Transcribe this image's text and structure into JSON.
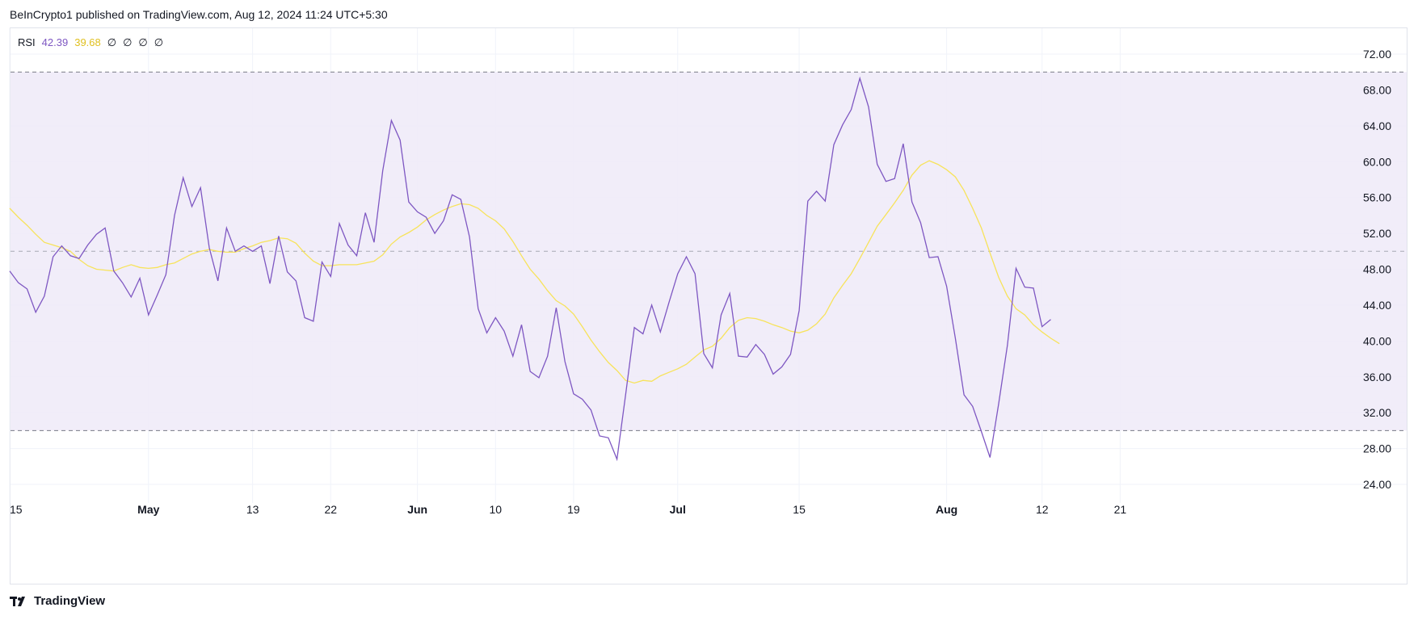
{
  "header": {
    "publish_line": "BeInCrypto1 published on TradingView.com, Aug 12, 2024 11:24 UTC+5:30"
  },
  "legend": {
    "indicator": "RSI",
    "rsi_value": "42.39",
    "ma_value": "39.68",
    "na_values": [
      "∅",
      "∅",
      "∅",
      "∅"
    ]
  },
  "footer": {
    "logo_text": "TradingView"
  },
  "colors": {
    "rsi_line": "#7e57c2",
    "ma_line": "#f7e35b",
    "band_fill": "#efebf8",
    "dashed": "#787b86",
    "grid": "#f0f3fa"
  },
  "chart_data": {
    "type": "line",
    "title": "RSI",
    "ylim": [
      22,
      74
    ],
    "y_ticks": [
      "72.00",
      "68.00",
      "64.00",
      "60.00",
      "56.00",
      "52.00",
      "48.00",
      "44.00",
      "40.00",
      "36.00",
      "32.00",
      "28.00",
      "24.00"
    ],
    "y_tick_values": [
      72,
      68,
      64,
      60,
      56,
      52,
      48,
      44,
      40,
      36,
      32,
      28,
      24
    ],
    "bands": {
      "upper": 70,
      "middle": 50,
      "lower": 30
    },
    "x_ticks": [
      {
        "label": "15",
        "index": 0,
        "bold": false
      },
      {
        "label": "May",
        "index": 16,
        "bold": true
      },
      {
        "label": "13",
        "index": 28,
        "bold": false
      },
      {
        "label": "22",
        "index": 37,
        "bold": false
      },
      {
        "label": "Jun",
        "index": 47,
        "bold": true
      },
      {
        "label": "10",
        "index": 56,
        "bold": false
      },
      {
        "label": "19",
        "index": 65,
        "bold": false
      },
      {
        "label": "Jul",
        "index": 77,
        "bold": true
      },
      {
        "label": "15",
        "index": 91,
        "bold": false
      },
      {
        "label": "Aug",
        "index": 108,
        "bold": true
      },
      {
        "label": "12",
        "index": 119,
        "bold": false
      },
      {
        "label": "21",
        "index": 128,
        "bold": false
      }
    ],
    "x_index_max": 137,
    "series": [
      {
        "name": "RSI",
        "values": [
          47.8,
          46.5,
          45.8,
          43.2,
          45.0,
          49.4,
          50.6,
          49.5,
          49.2,
          50.7,
          51.9,
          52.6,
          47.8,
          46.5,
          44.9,
          47.0,
          42.9,
          45.1,
          47.4,
          54.0,
          58.2,
          55.0,
          57.1,
          50.4,
          46.7,
          52.6,
          50.0,
          50.6,
          50.0,
          50.6,
          46.4,
          51.7,
          47.7,
          46.7,
          42.6,
          42.2,
          48.8,
          47.2,
          53.1,
          50.7,
          49.5,
          54.3,
          51.0,
          59.0,
          64.6,
          62.4,
          55.5,
          54.4,
          53.8,
          52.0,
          53.4,
          56.3,
          55.8,
          51.6,
          43.6,
          40.9,
          42.6,
          41.1,
          38.3,
          41.8,
          36.6,
          35.9,
          38.3,
          43.7,
          37.7,
          34.1,
          33.5,
          32.3,
          29.4,
          29.2,
          26.8,
          34.0,
          41.5,
          40.8,
          44.0,
          41.0,
          44.3,
          47.5,
          49.4,
          47.5,
          38.6,
          37.0,
          42.9,
          45.3,
          38.3,
          38.2,
          39.6,
          38.5,
          36.3,
          37.1,
          38.5,
          43.4,
          55.6,
          56.7,
          55.6,
          61.9,
          64.1,
          65.8,
          69.3,
          66.1,
          59.7,
          57.8,
          58.1,
          62.0,
          55.5,
          53.2,
          49.3,
          49.4,
          46.1,
          40.3,
          34.0,
          32.7,
          29.9,
          27.0,
          33.0,
          39.5,
          48.1,
          46.0,
          45.9,
          41.6,
          42.4
        ]
      },
      {
        "name": "RSI-based MA",
        "values": [
          54.8,
          53.8,
          52.9,
          51.9,
          51.0,
          50.7,
          50.4,
          50.0,
          49.1,
          48.4,
          48.0,
          47.9,
          47.8,
          48.2,
          48.5,
          48.2,
          48.1,
          48.2,
          48.5,
          48.7,
          49.2,
          49.7,
          50.0,
          50.2,
          50.0,
          49.9,
          49.9,
          50.3,
          50.6,
          51.0,
          51.2,
          51.5,
          51.4,
          50.9,
          49.8,
          48.9,
          48.4,
          48.4,
          48.5,
          48.5,
          48.5,
          48.7,
          48.9,
          49.6,
          50.8,
          51.6,
          52.1,
          52.7,
          53.5,
          54.1,
          54.6,
          55.0,
          55.3,
          55.2,
          54.8,
          54.0,
          53.4,
          52.5,
          51.1,
          49.5,
          48.0,
          46.9,
          45.6,
          44.5,
          43.9,
          43.0,
          41.6,
          40.1,
          38.8,
          37.6,
          36.7,
          35.6,
          35.3,
          35.6,
          35.5,
          36.1,
          36.5,
          36.9,
          37.4,
          38.2,
          39.0,
          39.4,
          40.3,
          41.5,
          42.3,
          42.6,
          42.5,
          42.2,
          41.8,
          41.5,
          41.1,
          40.9,
          41.2,
          41.9,
          43.0,
          44.8,
          46.2,
          47.5,
          49.2,
          51.0,
          52.8,
          54.1,
          55.4,
          56.8,
          58.5,
          59.6,
          60.1,
          59.7,
          59.1,
          58.3,
          56.8,
          54.8,
          52.6,
          49.8,
          47.1,
          45.0,
          43.6,
          42.9,
          41.8,
          41.0,
          40.3,
          39.7
        ]
      }
    ]
  }
}
